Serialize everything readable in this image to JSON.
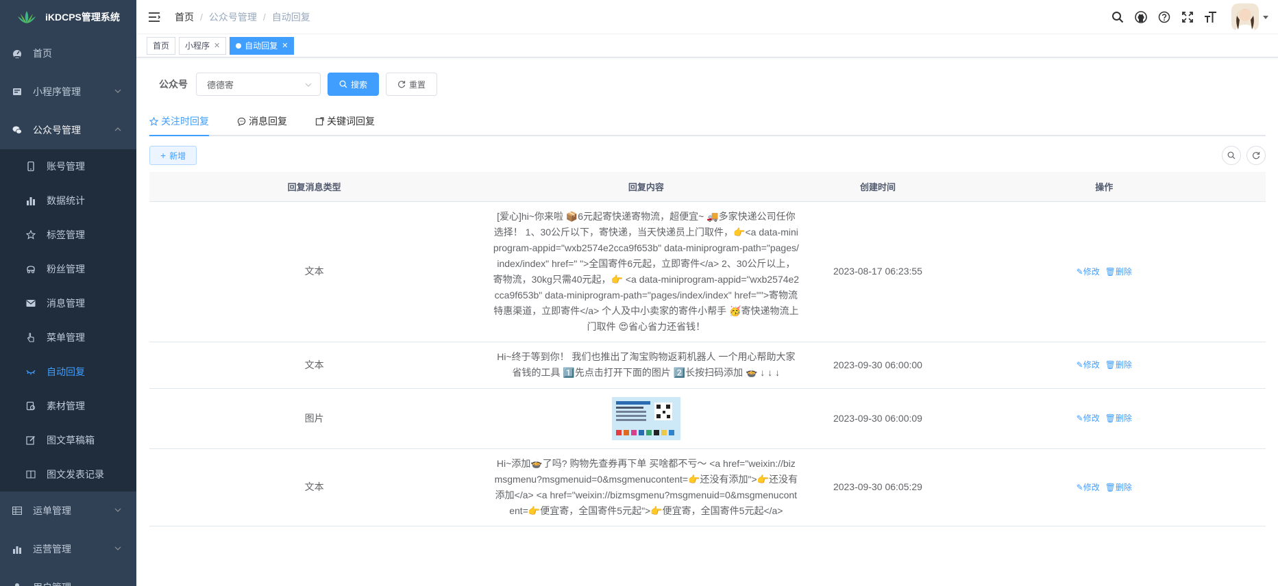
{
  "app": {
    "title": "iKDCPS管理系统"
  },
  "sidebar": {
    "items": [
      {
        "label": "首页",
        "icon": "dashboard-icon"
      },
      {
        "label": "小程序管理",
        "icon": "miniprogram-icon"
      },
      {
        "label": "公众号管理",
        "icon": "wechat-icon"
      }
    ],
    "sub_items": [
      {
        "label": "账号管理",
        "icon": "phone-icon"
      },
      {
        "label": "数据统计",
        "icon": "bar-chart-icon"
      },
      {
        "label": "标签管理",
        "icon": "star-icon"
      },
      {
        "label": "粉丝管理",
        "icon": "users-icon"
      },
      {
        "label": "消息管理",
        "icon": "message-icon"
      },
      {
        "label": "菜单管理",
        "icon": "pointer-icon"
      },
      {
        "label": "自动回复",
        "icon": "eye-icon"
      },
      {
        "label": "素材管理",
        "icon": "material-icon"
      },
      {
        "label": "图文草稿箱",
        "icon": "edit-icon"
      },
      {
        "label": "图文发表记录",
        "icon": "book-icon"
      }
    ],
    "bottom_items": [
      {
        "label": "运单管理",
        "icon": "table-icon"
      },
      {
        "label": "运营管理",
        "icon": "chart-icon"
      },
      {
        "label": "用户管理",
        "icon": "user-icon"
      }
    ]
  },
  "navbar": {
    "breadcrumb": [
      "首页",
      "公众号管理",
      "自动回复"
    ],
    "sep": "/"
  },
  "tags": [
    {
      "label": "首页"
    },
    {
      "label": "小程序"
    },
    {
      "label": "自动回复"
    }
  ],
  "filter": {
    "label": "公众号",
    "select_value": "德德寄",
    "search_btn": "搜索",
    "reset_btn": "重置"
  },
  "tabs": [
    {
      "label": "关注时回复"
    },
    {
      "label": "消息回复"
    },
    {
      "label": "关键词回复"
    }
  ],
  "toolbar": {
    "add_btn": "新增"
  },
  "table": {
    "headers": [
      "回复消息类型",
      "回复内容",
      "创建时间",
      "操作"
    ],
    "edit_label": "修改",
    "delete_label": "删除",
    "rows": [
      {
        "type": "文本",
        "content": "[爱心]hi~你来啦 📦6元起寄快递寄物流，超便宜~ 🚚多家快递公司任你选择！ 1、30公斤以下，寄快递，当天快递员上门取件，👉<a data-miniprogram-appid=\"wxb2574e2cca9f653b\" data-miniprogram-path=\"pages/index/index\" href=\" \">全国寄件6元起，立即寄件</a> 2、30公斤以上，寄物流，30kg只需40元起，👉 <a data-miniprogram-appid=\"wxb2574e2cca9f653b\" data-miniprogram-path=\"pages/index/index\" href=\"\">寄物流特惠渠道，立即寄件</a> 个人及中小卖家的寄件小帮手 🥳寄快递物流上门取件 😍省心省力还省钱！",
        "time": "2023-08-17 06:23:55"
      },
      {
        "type": "文本",
        "content": "Hi~终于等到你！ 我们也推出了淘宝购物返莉机器人 一个用心帮助大家省钱的工具 1️⃣先点击打开下面的图片 2️⃣长按扫码添加 🍲 ↓ ↓ ↓",
        "time": "2023-09-30 06:00:00"
      },
      {
        "type": "图片",
        "content": "",
        "time": "2023-09-30 06:00:09"
      },
      {
        "type": "文本",
        "content": "Hi~添加🍲了吗? 购物先查券再下单 买啥都不亏～ <a href=\"weixin://bizmsgmenu?msgmenuid=0&msgmenucontent=👉还没有添加\">👉还没有添加</a> <a href=\"weixin://bizmsgmenu?msgmenuid=0&msgmenucontent=👉便宜寄，全国寄件5元起\">👉便宜寄，全国寄件5元起</a>",
        "time": "2023-09-30 06:05:29"
      }
    ]
  },
  "colors": {
    "primary": "#409eff",
    "sidebar_bg": "#304156",
    "submenu_bg": "#1f2d3d"
  }
}
